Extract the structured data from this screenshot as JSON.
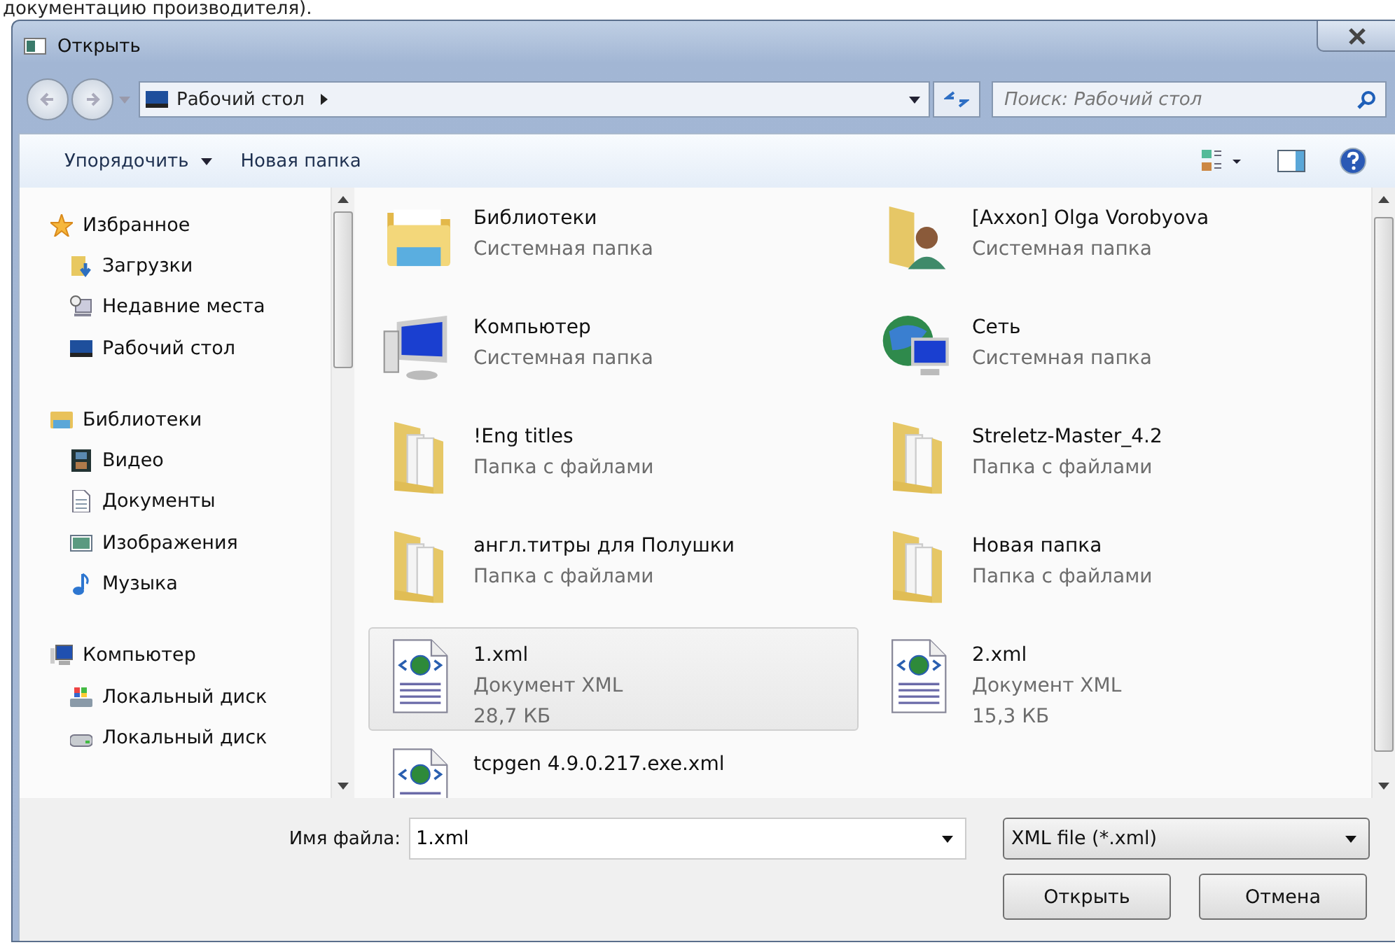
{
  "background_text": "документацию производителя).",
  "window": {
    "title": "Открыть"
  },
  "address_bar": {
    "path": "Рабочий стол",
    "search_placeholder": "Поиск: Рабочий стол"
  },
  "toolbar": {
    "organize": "Упорядочить",
    "new_folder": "Новая папка"
  },
  "sidebar": {
    "groups": [
      {
        "label": "Избранное",
        "kind": "star",
        "children": [
          {
            "label": "Загрузки",
            "kind": "downloads"
          },
          {
            "label": "Недавние места",
            "kind": "recent"
          },
          {
            "label": "Рабочий стол",
            "kind": "desktop"
          }
        ]
      },
      {
        "label": "Библиотеки",
        "kind": "library",
        "children": [
          {
            "label": "Видео",
            "kind": "video"
          },
          {
            "label": "Документы",
            "kind": "docs"
          },
          {
            "label": "Изображения",
            "kind": "pictures"
          },
          {
            "label": "Музыка",
            "kind": "music"
          }
        ]
      },
      {
        "label": "Компьютер",
        "kind": "computer",
        "children": [
          {
            "label": "Локальный диск",
            "kind": "sysdisk"
          },
          {
            "label": "Локальный диск",
            "kind": "disk"
          }
        ]
      }
    ]
  },
  "files": [
    {
      "name": "Библиотеки",
      "type": "Системная папка",
      "kind": "library",
      "selected": false
    },
    {
      "name": "[Axxon] Olga Vorobyova",
      "type": "Системная папка",
      "kind": "user",
      "selected": false
    },
    {
      "name": "Компьютер",
      "type": "Системная папка",
      "kind": "computer",
      "selected": false
    },
    {
      "name": "Сеть",
      "type": "Системная папка",
      "kind": "network",
      "selected": false
    },
    {
      "name": "!Eng titles",
      "type": "Папка с файлами",
      "kind": "folder",
      "selected": false
    },
    {
      "name": "Streletz-Master_4.2",
      "type": "Папка с файлами",
      "kind": "folder",
      "selected": false
    },
    {
      "name": "англ.титры для Полушки",
      "type": "Папка с файлами",
      "kind": "folder",
      "selected": false
    },
    {
      "name": "Новая папка",
      "type": "Папка с файлами",
      "kind": "folder",
      "selected": false
    },
    {
      "name": "1.xml",
      "type": "Документ XML",
      "size": "28,7 КБ",
      "kind": "xml",
      "selected": true
    },
    {
      "name": "2.xml",
      "type": "Документ XML",
      "size": "15,3 КБ",
      "kind": "xml",
      "selected": false
    },
    {
      "name": "tcpgen 4.9.0.217.exe.xml",
      "kind": "xml",
      "selected": false
    }
  ],
  "footer": {
    "filename_label": "Имя файла:",
    "filename": "1.xml",
    "filter": "XML file (*.xml)",
    "open": "Открыть",
    "cancel": "Отмена"
  }
}
